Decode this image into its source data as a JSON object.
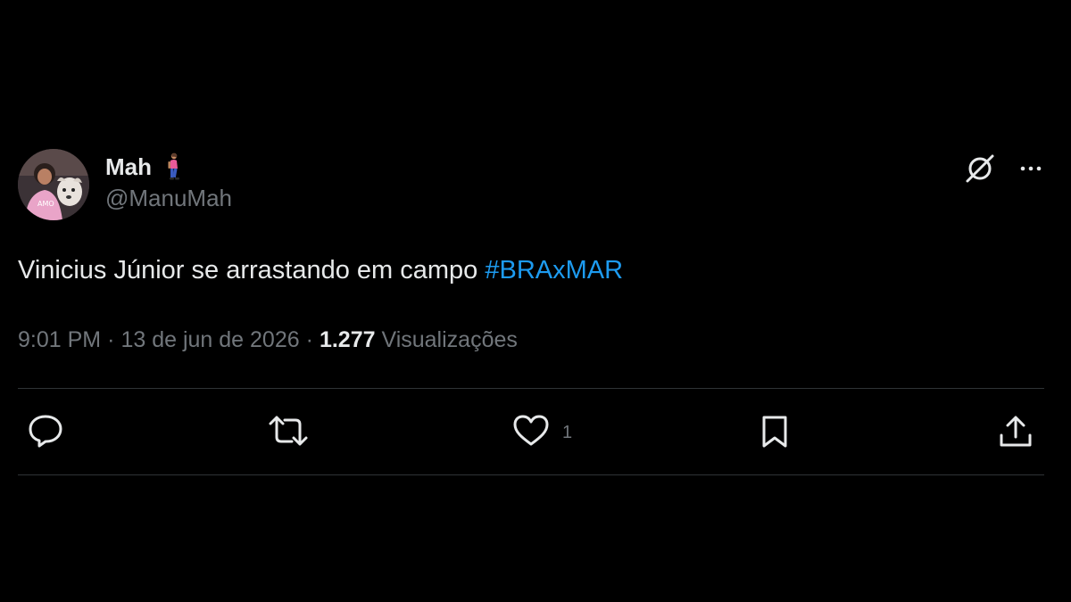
{
  "tweet": {
    "author": {
      "display_name": "Mah",
      "name_emoji": "woman-walking-emoji",
      "handle": "@ManuMah",
      "avatar": "profile-photo"
    },
    "text_plain": "Vinicius Júnior se arrastando em campo ",
    "hashtag": "#BRAxMAR",
    "meta": {
      "time": "9:01 PM",
      "separator1": "·",
      "date": "13 de jun de 2026",
      "separator2": "·",
      "views_count": "1.277",
      "views_label": "Visualizações"
    },
    "actions": {
      "reply": {
        "icon": "reply-icon"
      },
      "retweet": {
        "icon": "retweet-icon"
      },
      "like": {
        "icon": "heart-icon",
        "count": "1"
      },
      "bookmark": {
        "icon": "bookmark-icon"
      },
      "share": {
        "icon": "share-icon"
      }
    },
    "header_actions": {
      "grok": {
        "icon": "grok-icon"
      },
      "more": {
        "icon": "more-icon"
      }
    }
  },
  "colors": {
    "background": "#000000",
    "text_primary": "#e7e9ea",
    "text_secondary": "#71767b",
    "accent": "#1d9bf0",
    "divider": "#2f3336"
  }
}
